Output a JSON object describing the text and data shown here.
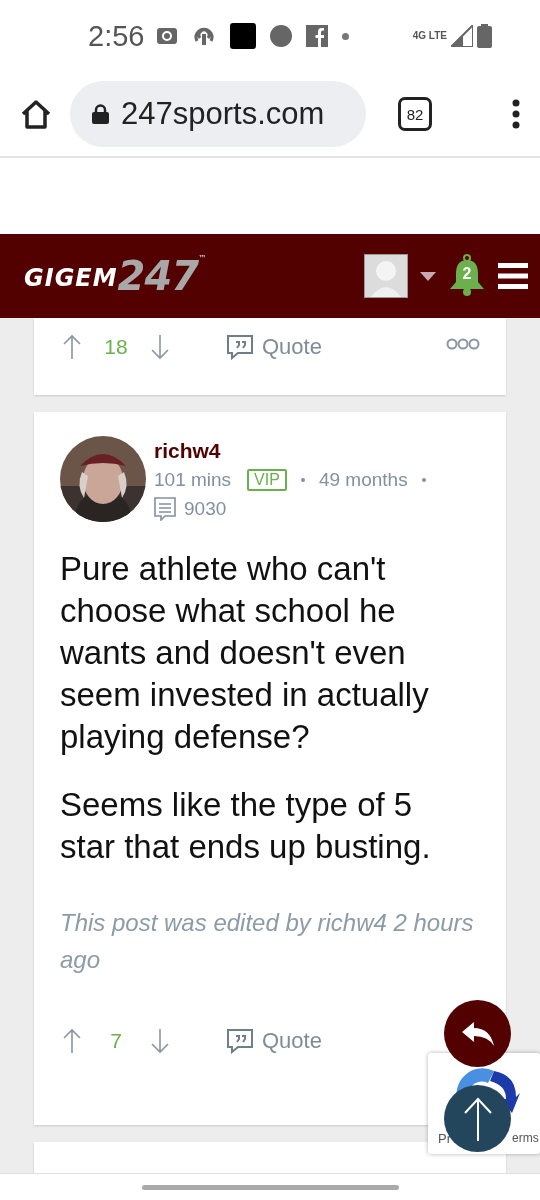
{
  "status_bar": {
    "time": "2:56",
    "network": "4G LTE"
  },
  "browser": {
    "url": "247sports.com",
    "tab_count": "82"
  },
  "header": {
    "logo_primary": "GIGEM",
    "logo_secondary": "247",
    "logo_mark": "™",
    "notification_count": "2"
  },
  "previous_post": {
    "votes": "18",
    "quote_label": "Quote"
  },
  "post": {
    "author": "richw4",
    "time": "101 mins",
    "badge": "VIP",
    "tenure": "49 months",
    "post_count": "9030",
    "paragraphs": [
      "Pure athlete who can't choose what school he wants and doesn't even seem invested in actually playing defense?",
      "Seems like the type of 5 star that ends up busting."
    ],
    "edit_note": "This post was edited by richw4 2 hours ago",
    "votes": "7",
    "quote_label": "Quote"
  },
  "recaptcha": {
    "left_text": "Pr",
    "right_text": "erms"
  }
}
